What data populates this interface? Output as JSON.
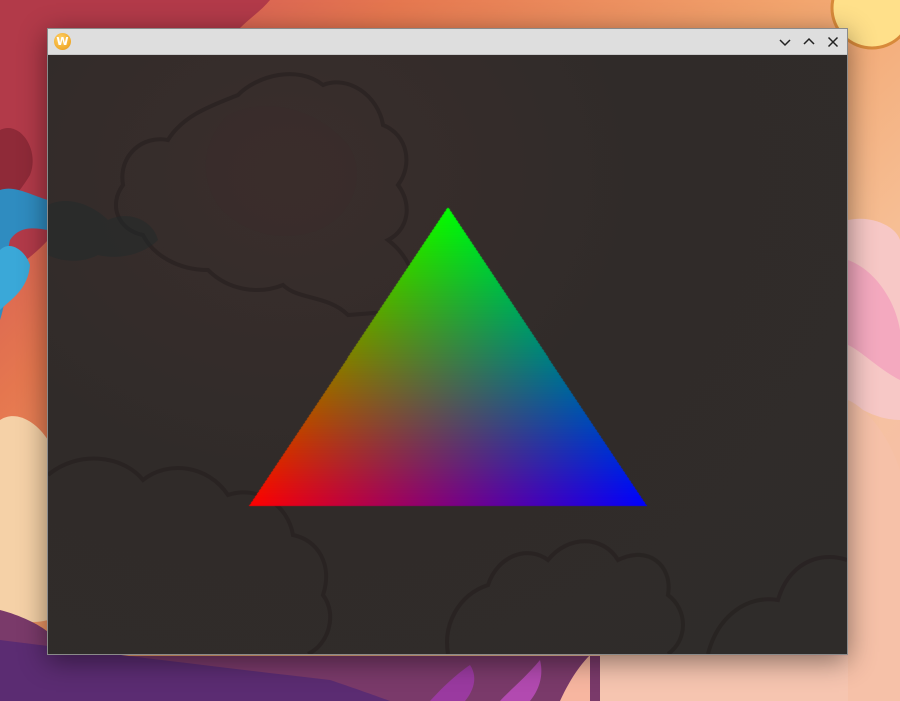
{
  "desktop": {
    "wallpaper": "illustrated-cartoon-landscape"
  },
  "window": {
    "title": "",
    "app_icon": {
      "name": "wayland-icon",
      "glyph": "W"
    },
    "buttons": [
      {
        "name": "minimize-button",
        "icon": "chevron-down-icon"
      },
      {
        "name": "maximize-button",
        "icon": "chevron-up-icon"
      },
      {
        "name": "close-button",
        "icon": "close-icon"
      }
    ],
    "client_background": "#2e2b2a"
  },
  "scene": {
    "shape": "triangle",
    "vertex_colors": {
      "top": "#00ff00",
      "bottom_left": "#ff0000",
      "bottom_right": "#0000ff"
    }
  }
}
